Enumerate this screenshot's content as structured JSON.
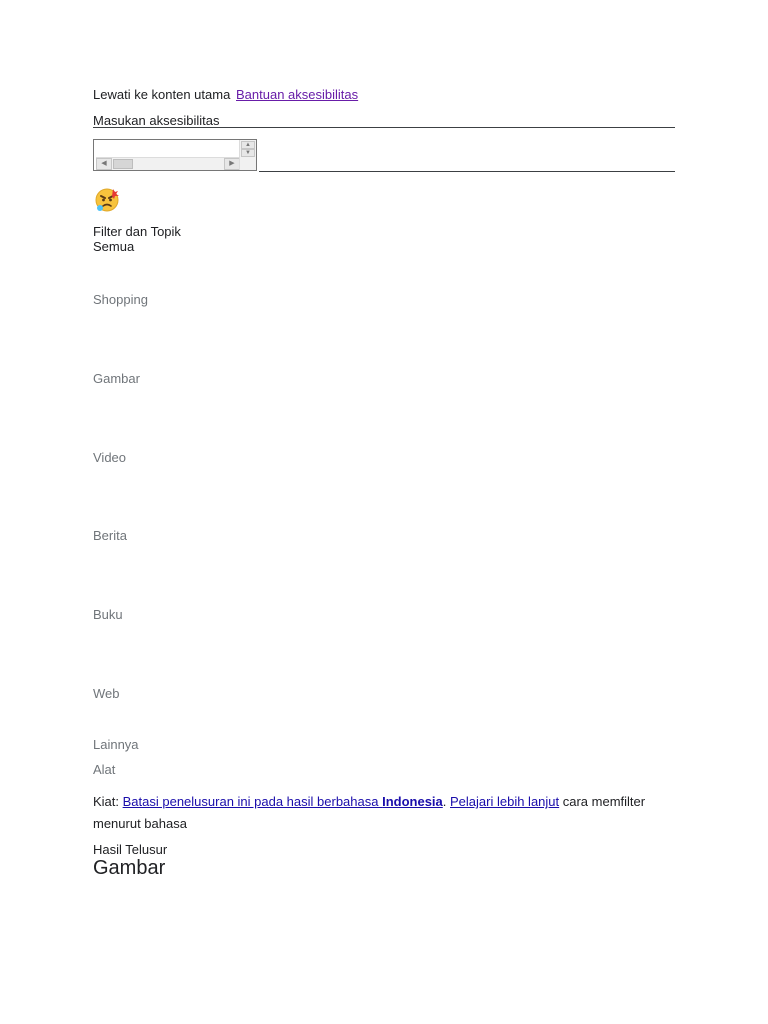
{
  "header": {
    "skip_link": "Lewati ke konten utama",
    "accessibility_help": "Bantuan aksesibilitas",
    "accessibility_feedback": "Masukan aksesibilitas"
  },
  "doodle": {
    "icon": "angry-face-emoji-icon"
  },
  "filters": {
    "title": "Filter dan Topik",
    "active": "Semua",
    "items": [
      {
        "label": "Shopping"
      },
      {
        "label": "Gambar"
      },
      {
        "label": "Video"
      },
      {
        "label": "Berita"
      },
      {
        "label": "Buku"
      },
      {
        "label": "Web"
      },
      {
        "label": "Lainnya"
      },
      {
        "label": "Alat"
      }
    ]
  },
  "tip": {
    "prefix": "Kiat: ",
    "link1_text": "Batasi penelusuran ini pada hasil berbahasa ",
    "link1_bold": "Indonesia",
    "separator": ". ",
    "link2_text": "Pelajari lebih lanjut",
    "suffix": " cara memfilter menurut bahasa"
  },
  "results": {
    "title": "Hasil Telusur",
    "section_heading": "Gambar"
  },
  "colors": {
    "link_visited": "#681da8",
    "link": "#1a0dab",
    "muted_text": "#70757a",
    "text": "#202124"
  }
}
